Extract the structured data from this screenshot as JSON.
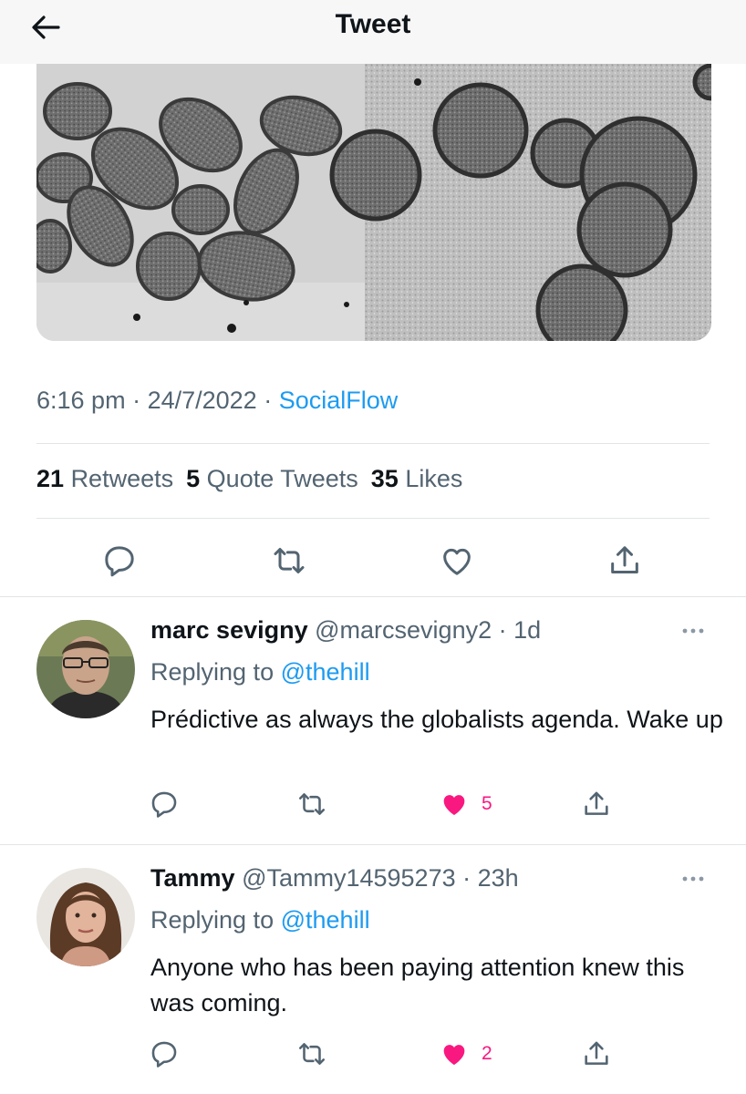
{
  "header": {
    "title": "Tweet",
    "back_icon": "arrow-left-icon"
  },
  "tweet": {
    "time": "6:16 pm",
    "date": "24/7/2022",
    "source": "SocialFlow",
    "stats": {
      "retweets_count": "21",
      "retweets_label": "Retweets",
      "quotes_count": "5",
      "quotes_label": "Quote Tweets",
      "likes_count": "35",
      "likes_label": "Likes"
    },
    "actions": [
      "reply-icon",
      "retweet-icon",
      "like-icon",
      "share-icon"
    ]
  },
  "replies": [
    {
      "name": "marc sevigny",
      "handle": "@marcsevigny2",
      "age": "1d",
      "replying_prefix": "Replying to",
      "replying_to": "@thehill",
      "text": "Prédictive as always the globalists agenda. Wake up",
      "likes": "5",
      "liked": true
    },
    {
      "name": "Tammy",
      "handle": "@Tammy14595273",
      "age": "23h",
      "replying_prefix": "Replying to",
      "replying_to": "@thehill",
      "text": "Anyone who has been paying attention knew this was coming.",
      "likes": "2",
      "liked": true
    }
  ],
  "colors": {
    "accent": "#1d9bf0",
    "like": "#f91880",
    "muted": "#536471",
    "text": "#0f1419",
    "header_bg": "#f7f7f7"
  }
}
